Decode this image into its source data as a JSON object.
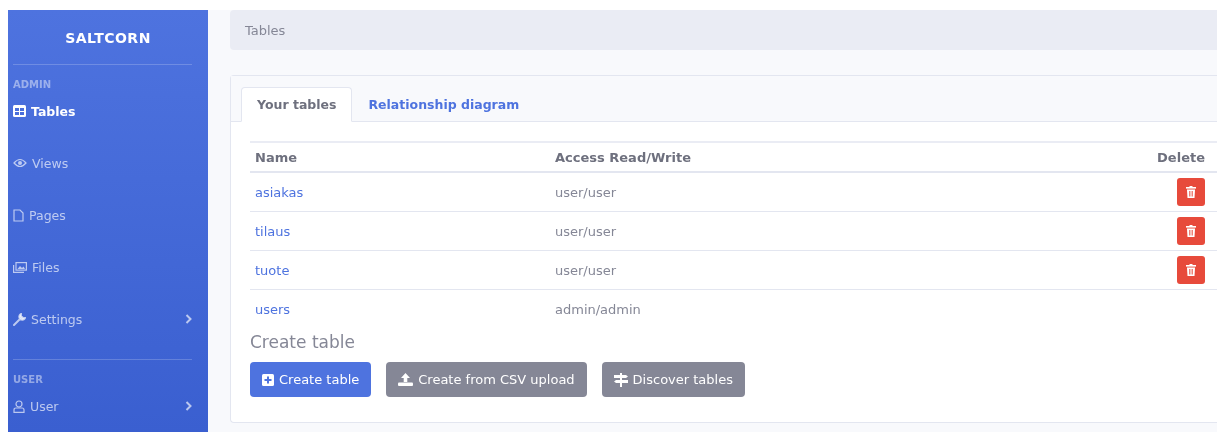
{
  "sidebar": {
    "brand": "SALTCORN",
    "sections": [
      {
        "heading": "ADMIN",
        "items": [
          {
            "label": "Tables",
            "kind": "table",
            "selected": true,
            "expandable": false
          },
          {
            "label": "Views",
            "kind": "eye",
            "selected": false,
            "expandable": false
          },
          {
            "label": "Pages",
            "kind": "file",
            "selected": false,
            "expandable": false
          },
          {
            "label": "Files",
            "kind": "images",
            "selected": false,
            "expandable": false
          },
          {
            "label": "Settings",
            "kind": "wrench",
            "selected": false,
            "expandable": true
          }
        ]
      },
      {
        "heading": "USER",
        "items": [
          {
            "label": "User",
            "kind": "user",
            "selected": false,
            "expandable": true
          }
        ]
      }
    ]
  },
  "breadcrumb": "Tables",
  "tabs": [
    {
      "label": "Your tables",
      "selected": true
    },
    {
      "label": "Relationship diagram",
      "selected": false
    }
  ],
  "table": {
    "columns": [
      "Name",
      "Access Read/Write",
      "Delete"
    ],
    "rows": [
      {
        "name": "asiakas",
        "access": "user/user",
        "deletable": true
      },
      {
        "name": "tilaus",
        "access": "user/user",
        "deletable": true
      },
      {
        "name": "tuote",
        "access": "user/user",
        "deletable": true
      },
      {
        "name": "users",
        "access": "admin/admin",
        "deletable": false
      }
    ]
  },
  "create": {
    "heading": "Create table",
    "buttons": [
      {
        "label": "Create table",
        "kind": "create"
      },
      {
        "label": "Create from CSV upload",
        "kind": "upload"
      },
      {
        "label": "Discover tables",
        "kind": "discover"
      }
    ]
  }
}
